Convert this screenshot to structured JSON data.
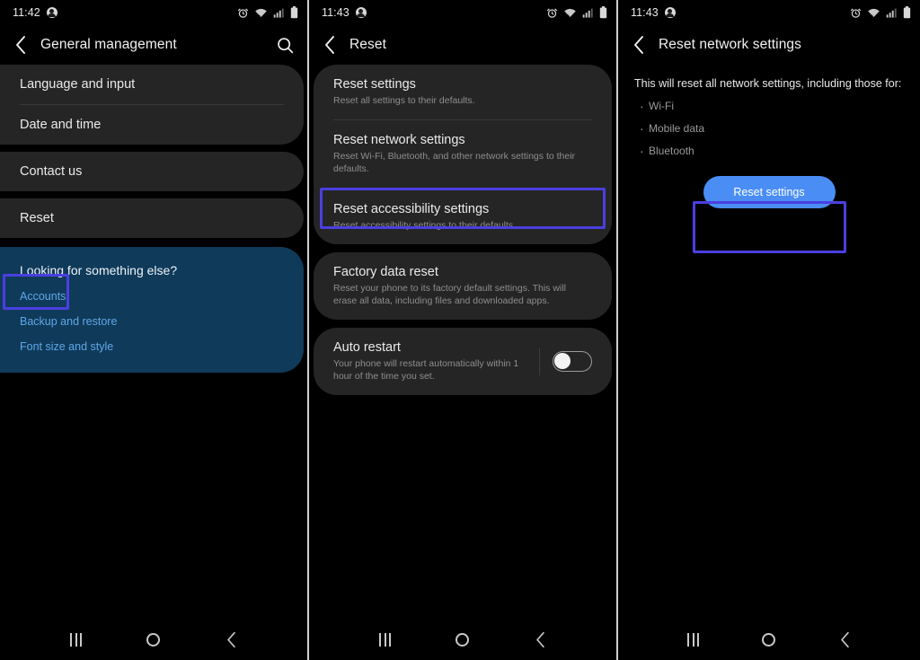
{
  "panels": [
    {
      "id": "general-management",
      "statusbar": {
        "time": "11:42",
        "icons": [
          "person-icon",
          "alarm-icon",
          "wifi-icon",
          "signal-icon",
          "battery-icon"
        ]
      },
      "appbar": {
        "back_icon": "back-chevron-icon",
        "title": "General management",
        "action_icon": "search-icon"
      },
      "cards": [
        {
          "rows": [
            {
              "title": "Language and input"
            },
            {
              "title": "Date and time"
            }
          ]
        },
        {
          "rows": [
            {
              "title": "Contact us"
            }
          ]
        },
        {
          "rows": [
            {
              "title": "Reset"
            }
          ]
        }
      ],
      "promo": {
        "title": "Looking for something else?",
        "links": [
          "Accounts",
          "Backup and restore",
          "Font size and style"
        ]
      },
      "highlight": "Reset"
    },
    {
      "id": "reset",
      "statusbar": {
        "time": "11:43",
        "icons": [
          "person-icon",
          "alarm-icon",
          "wifi-icon",
          "signal-icon",
          "battery-icon"
        ]
      },
      "appbar": {
        "back_icon": "back-chevron-icon",
        "title": "Reset",
        "action_icon": null
      },
      "cards": [
        {
          "rows": [
            {
              "title": "Reset settings",
              "sub": "Reset all settings to their defaults."
            },
            {
              "title": "Reset network settings",
              "sub": "Reset Wi-Fi, Bluetooth, and other network settings to their defaults."
            },
            {
              "title": "Reset accessibility settings",
              "sub": "Reset accessibility settings to their defaults."
            }
          ]
        },
        {
          "rows": [
            {
              "title": "Factory data reset",
              "sub": "Reset your phone to its factory default settings. This will erase all data, including files and downloaded apps."
            }
          ]
        },
        {
          "rows": [
            {
              "title": "Auto restart",
              "sub": "Your phone will restart automatically within 1 hour of the time you set.",
              "toggle": "off"
            }
          ]
        }
      ],
      "highlight": "Reset network settings"
    },
    {
      "id": "reset-network-settings",
      "statusbar": {
        "time": "11:43",
        "icons": [
          "person-icon",
          "alarm-icon",
          "wifi-icon",
          "signal-icon",
          "battery-icon"
        ]
      },
      "appbar": {
        "back_icon": "back-chevron-icon",
        "title": "Reset network settings",
        "action_icon": null
      },
      "lead": "This will reset all network settings, including those for:",
      "bullets": [
        "Wi-Fi",
        "Mobile data",
        "Bluetooth"
      ],
      "button": "Reset settings",
      "highlight": "Reset settings"
    }
  ],
  "navbar": {
    "recents_icon": "recents-icon",
    "home_icon": "home-icon",
    "back_icon": "back-chevron-icon"
  },
  "colors": {
    "highlight_box": "#4b3fe0",
    "primary_button": "#4a8ef5",
    "promo_card": "#0f3a5a",
    "promo_link": "#5fa8e8",
    "card_bg": "#252525",
    "screen_bg": "#000000"
  }
}
